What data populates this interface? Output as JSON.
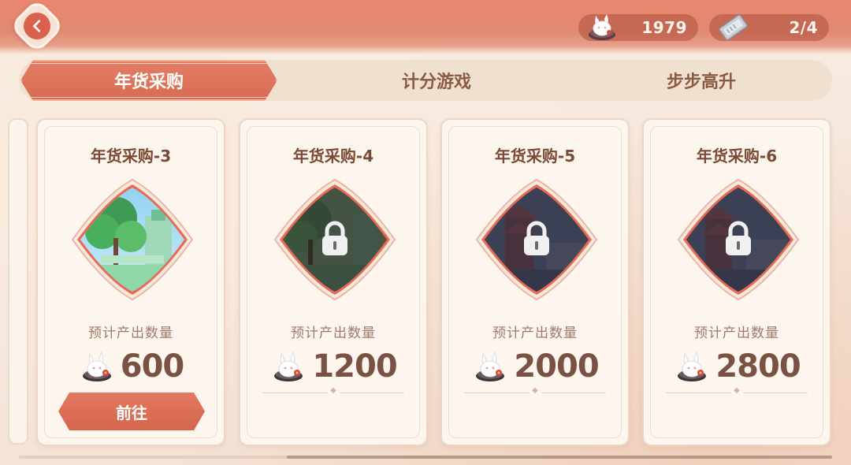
{
  "currencies": [
    {
      "icon": "rabbit-coin-icon",
      "value": "1979"
    },
    {
      "icon": "ticket-icon",
      "value": "2/4"
    }
  ],
  "tabs": [
    {
      "label": "年货采购",
      "active": true
    },
    {
      "label": "计分游戏",
      "active": false
    },
    {
      "label": "步步高升",
      "active": false
    }
  ],
  "cards": [
    {
      "title": "年货采购-3",
      "label": "预计产出数量",
      "amount": "600",
      "locked": false,
      "button": "前往"
    },
    {
      "title": "年货采购-4",
      "label": "预计产出数量",
      "amount": "1200",
      "locked": true
    },
    {
      "title": "年货采购-5",
      "label": "预计产出数量",
      "amount": "2000",
      "locked": true
    },
    {
      "title": "年货采购-6",
      "label": "预计产出数量",
      "amount": "2800",
      "locked": true
    }
  ],
  "colors": {
    "accent": "#d86a52",
    "card_bg": "#fcf6ef",
    "text_dark": "#7a4a35"
  }
}
